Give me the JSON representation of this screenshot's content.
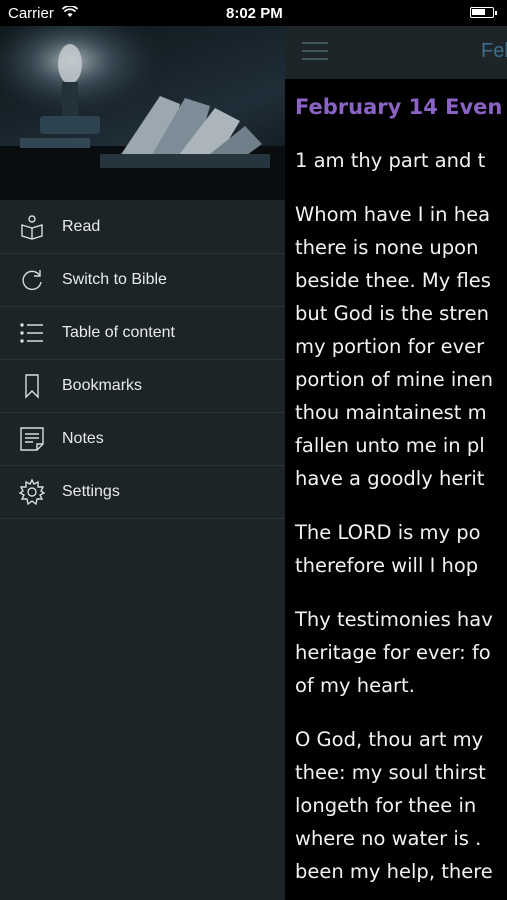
{
  "status_bar": {
    "carrier": "Carrier",
    "time": "8:02 PM"
  },
  "drawer": {
    "menu": [
      {
        "label": "Read",
        "icon": "book-reader-icon"
      },
      {
        "label": "Switch to Bible",
        "icon": "refresh-icon"
      },
      {
        "label": "Table of content",
        "icon": "list-icon"
      },
      {
        "label": "Bookmarks",
        "icon": "bookmark-icon"
      },
      {
        "label": "Notes",
        "icon": "notes-icon"
      },
      {
        "label": "Settings",
        "icon": "gear-icon"
      }
    ]
  },
  "main": {
    "nav_title": "Feb",
    "day_title": "February 14 Even",
    "paragraphs": [
      [
        "1 am thy part and t"
      ],
      [
        "Whom have I in hea",
        "there is none upon",
        "beside thee. My fles",
        "but God is the stren",
        "my portion for ever",
        "portion of mine inen",
        "thou maintainest m",
        "fallen unto me in pl",
        "have a goodly herit"
      ],
      [
        "The LORD is my po",
        "therefore will I hop"
      ],
      [
        "Thy testimonies hav",
        "heritage for ever: fo",
        "of my heart."
      ],
      [
        "O God, thou art my",
        "thee: my soul thirst",
        "longeth for thee in",
        "where no water is .",
        "been my help, there"
      ]
    ]
  },
  "colors": {
    "drawer_bg": "#1c2428",
    "navbar_bg": "#1e2529",
    "title_purple": "#8a63c4",
    "nav_title_blue": "#3c6d8a"
  }
}
